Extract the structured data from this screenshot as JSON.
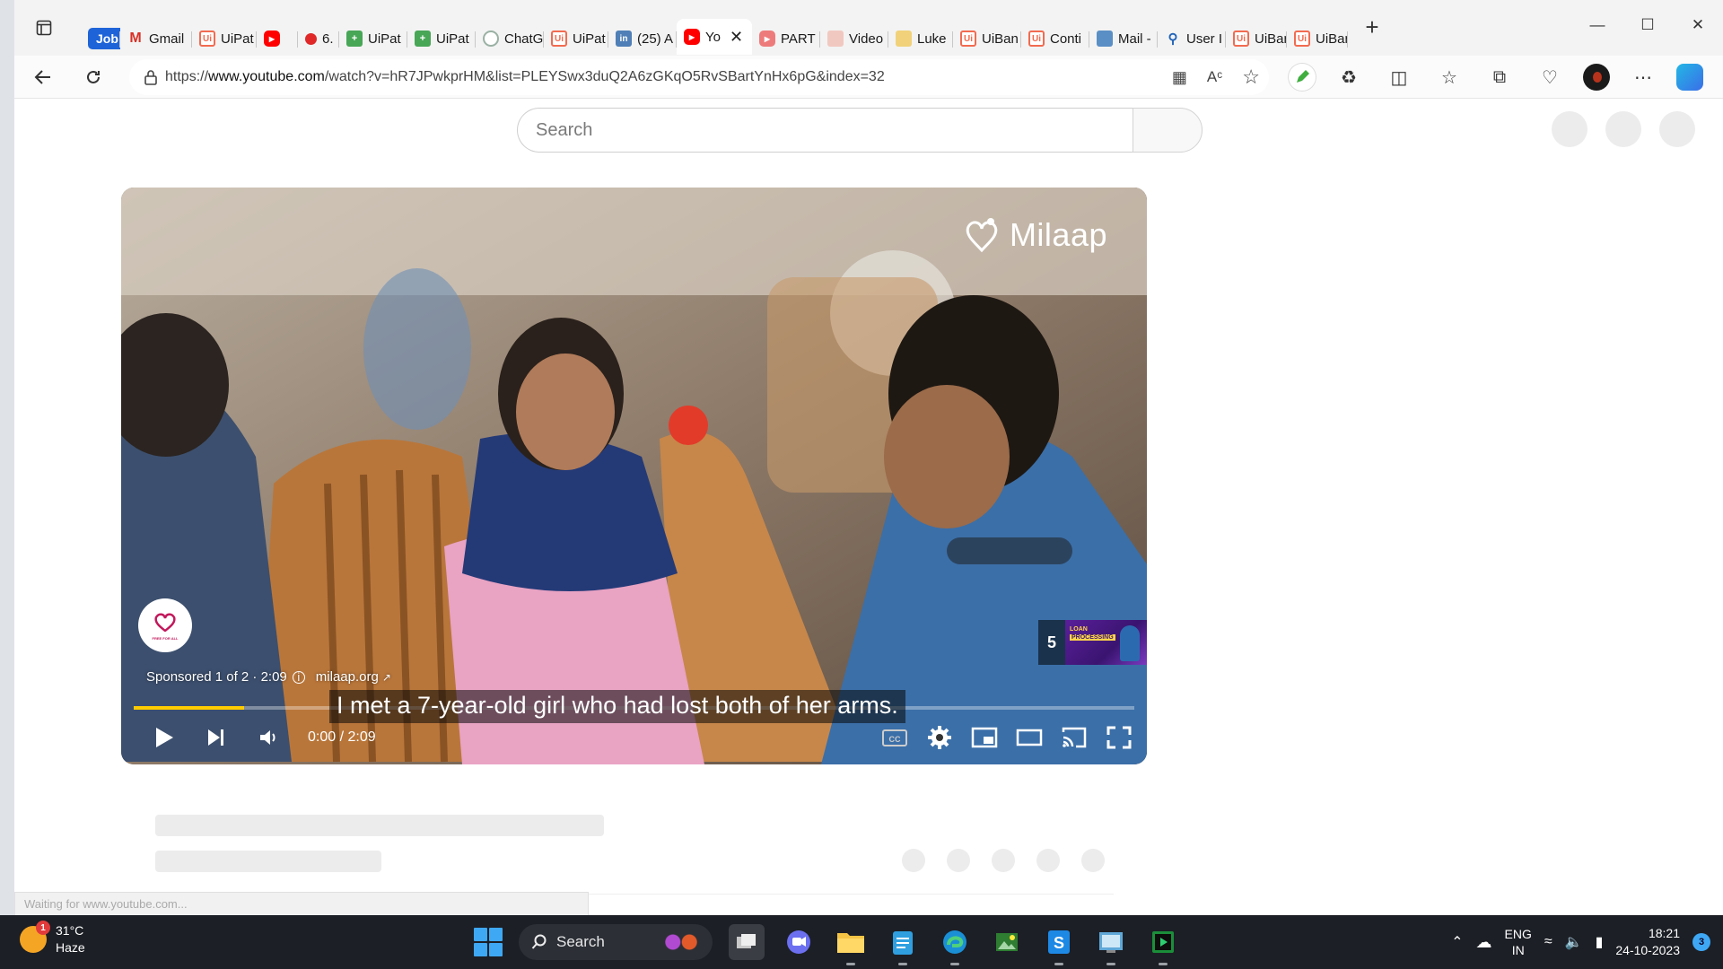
{
  "browser": {
    "tabs": [
      {
        "label": "Job",
        "icon": "job-pill"
      },
      {
        "label": "Gmail",
        "icon": "gmail-icon"
      },
      {
        "label": "UiPat",
        "icon": "uipath-icon"
      },
      {
        "label": "",
        "icon": "youtube-icon"
      },
      {
        "label": "6.",
        "icon": "record-icon"
      },
      {
        "label": "UiPat",
        "icon": "sheets-icon"
      },
      {
        "label": "UiPat",
        "icon": "sheets-icon"
      },
      {
        "label": "ChatG",
        "icon": "chatgpt-icon"
      },
      {
        "label": "UiPat",
        "icon": "uipath-icon"
      },
      {
        "label": "(25) A",
        "icon": "linkedin-icon"
      },
      {
        "label": "Yo",
        "icon": "youtube-icon",
        "active": true
      },
      {
        "label": "PART",
        "icon": "youtube-icon"
      },
      {
        "label": "Video",
        "icon": "video-icon"
      },
      {
        "label": "Luke",
        "icon": "luke-icon"
      },
      {
        "label": "UiBan",
        "icon": "uipath-icon"
      },
      {
        "label": "Conti",
        "icon": "uipath-icon"
      },
      {
        "label": "Mail -",
        "icon": "mail-icon"
      },
      {
        "label": "User I",
        "icon": "search-icon"
      },
      {
        "label": "UiBan",
        "icon": "uipath-icon"
      },
      {
        "label": "UiBan",
        "icon": "uipath-icon"
      }
    ],
    "url_prefix": "https://",
    "url_host": "www.youtube.com",
    "url_path": "/watch?v=hR7JPwkprHM&list=PLEYSwx3duQ2A6zGKqO5RvSBartYnHx6pG&index=32",
    "status_text": "Waiting for www.youtube.com..."
  },
  "youtube": {
    "search_placeholder": "Search",
    "player": {
      "brand": "Milaap",
      "ad_label": "Sponsored 1 of 2 · 2:09",
      "ad_domain": "milaap.org",
      "avatar_text": "FREE FOR ALL",
      "caption": "I met a 7-year-old girl who had lost both of her arms.",
      "time": "0:00 / 2:09",
      "progress_fraction": 0.11,
      "up_next_count": "5",
      "up_next_title_1": "LOAN",
      "up_next_title_2": "PROCESSING",
      "progress_color": "#ffcc00"
    }
  },
  "taskbar": {
    "temp": "31°C",
    "weather": "Haze",
    "weather_badge": "1",
    "search_label": "Search",
    "lang_1": "ENG",
    "lang_2": "IN",
    "time": "18:21",
    "date": "24-10-2023",
    "notifications": "3"
  }
}
